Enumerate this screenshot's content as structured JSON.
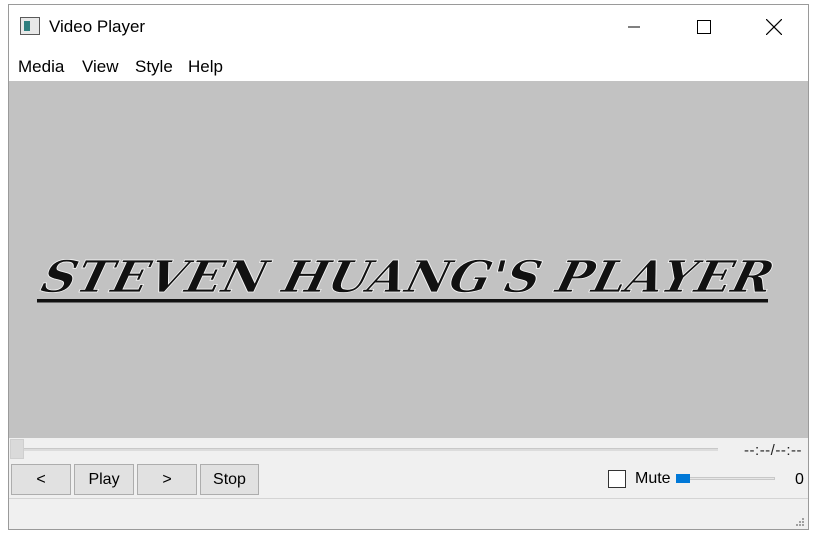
{
  "window": {
    "title": "Video Player"
  },
  "menu": [
    "Media",
    "View",
    "Style",
    "Help"
  ],
  "video": {
    "logo_text": "STEVEN HUANG'S PLAYER",
    "background": "#c2c2c2"
  },
  "seek": {
    "position": 0,
    "time_label": "--:--/--:--"
  },
  "controls": {
    "prev_label": "<",
    "play_label": "Play",
    "next_label": ">",
    "stop_label": "Stop"
  },
  "audio": {
    "mute_label": "Mute",
    "muted": false,
    "volume": 0,
    "volume_text": "0"
  },
  "colors": {
    "accent": "#0078d7",
    "window_bg": "#f0f0f0",
    "logo": "#111111"
  },
  "icons": {
    "app": "app-window-icon",
    "minimize": "minimize-icon",
    "maximize": "maximize-icon",
    "close": "close-icon",
    "grip": "size-grip-icon"
  }
}
